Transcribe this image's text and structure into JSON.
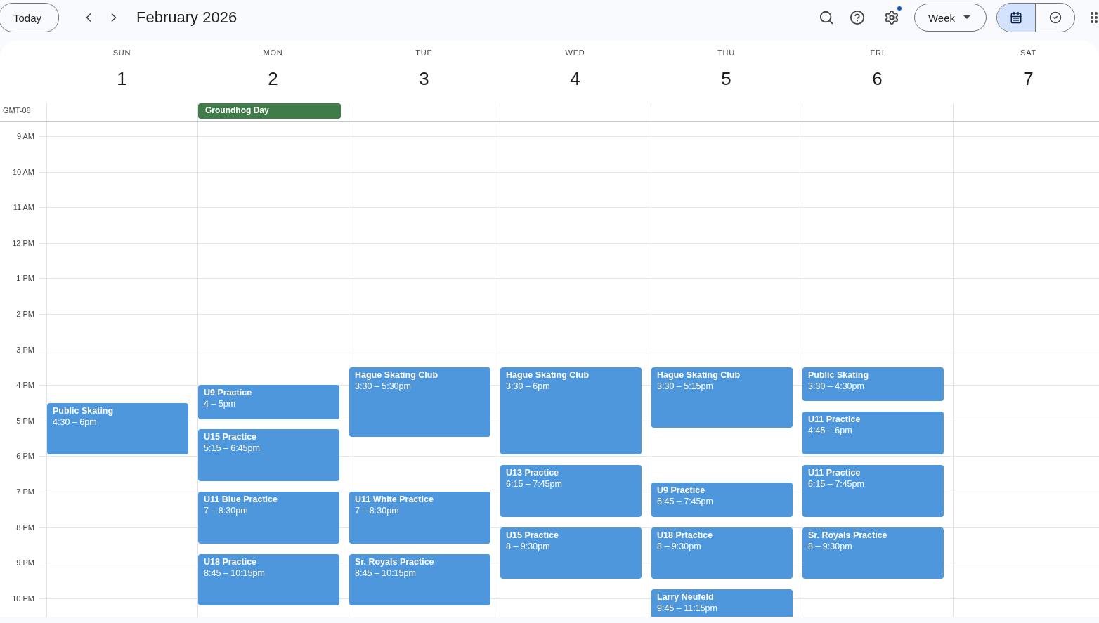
{
  "toolbar": {
    "today": "Today",
    "title": "February 2026",
    "view_select": "Week",
    "view_toggle": [
      {
        "kind": "calendar",
        "selected": true
      },
      {
        "kind": "tasks",
        "selected": false
      }
    ]
  },
  "timezone": "GMT-06",
  "hours": [
    "9 AM",
    "10 AM",
    "11 AM",
    "12 PM",
    "1 PM",
    "2 PM",
    "3 PM",
    "4 PM",
    "5 PM",
    "6 PM",
    "7 PM",
    "8 PM",
    "9 PM",
    "10 PM"
  ],
  "days": [
    {
      "name": "SUN",
      "number": "1",
      "events": [
        {
          "title": "Public Skating",
          "time": "4:30 – 6pm"
        }
      ]
    },
    {
      "name": "MON",
      "number": "2",
      "all_day": [
        {
          "title": "Groundhog Day",
          "color": "#3f7c49"
        }
      ],
      "events": [
        {
          "title": "U9 Practice",
          "time": "4 – 5pm"
        },
        {
          "title": "U15 Practice",
          "time": "5:15 – 6:45pm"
        },
        {
          "title": "U11 Blue Practice",
          "time": "7 – 8:30pm"
        },
        {
          "title": "U18 Practice",
          "time": "8:45 – 10:15pm"
        }
      ]
    },
    {
      "name": "TUE",
      "number": "3",
      "events": [
        {
          "title": "Hague Skating Club",
          "time": "3:30 – 5:30pm"
        },
        {
          "title": "U11 White Practice",
          "time": "7 – 8:30pm"
        },
        {
          "title": "Sr. Royals Practice",
          "time": "8:45 – 10:15pm"
        }
      ]
    },
    {
      "name": "WED",
      "number": "4",
      "events": [
        {
          "title": "Hague Skating Club",
          "time": "3:30 – 6pm"
        },
        {
          "title": "U13 Practice",
          "time": "6:15 – 7:45pm"
        },
        {
          "title": "U15 Practice",
          "time": "8 – 9:30pm"
        }
      ]
    },
    {
      "name": "THU",
      "number": "5",
      "events": [
        {
          "title": "Hague Skating Club",
          "time": "3:30 – 5:15pm"
        },
        {
          "title": "U9 Practice",
          "time": "6:45 – 7:45pm"
        },
        {
          "title": "U18 Prtactice",
          "time": "8 – 9:30pm"
        },
        {
          "title": "Larry Neufeld",
          "time": "9:45 – 11:15pm"
        }
      ]
    },
    {
      "name": "FRI",
      "number": "6",
      "events": [
        {
          "title": "Public Skating",
          "time": "3:30 – 4:30pm"
        },
        {
          "title": "U11 Practice",
          "time": "4:45 – 6pm"
        },
        {
          "title": "U11 Practice",
          "time": "6:15 – 7:45pm"
        },
        {
          "title": "Sr. Royals Practice",
          "time": "8 – 9:30pm"
        }
      ]
    },
    {
      "name": "SAT",
      "number": "7"
    }
  ]
}
